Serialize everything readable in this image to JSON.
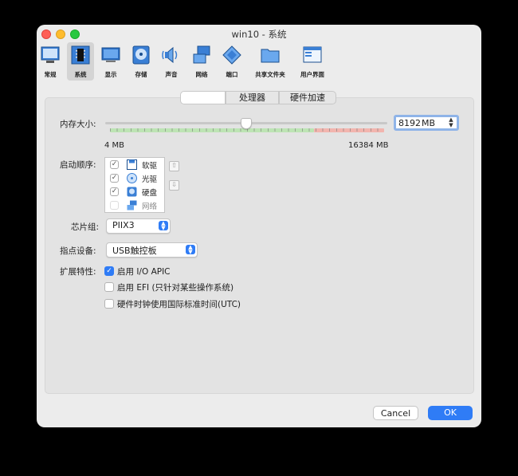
{
  "window": {
    "title": "win10 - 系统"
  },
  "toolbar": [
    {
      "label": "常规",
      "icon": "general-icon"
    },
    {
      "label": "系统",
      "icon": "chip-icon",
      "selected": true
    },
    {
      "label": "显示",
      "icon": "monitor-icon"
    },
    {
      "label": "存储",
      "icon": "storage-icon"
    },
    {
      "label": "声音",
      "icon": "speaker-icon"
    },
    {
      "label": "网络",
      "icon": "network-icon"
    },
    {
      "label": "端口",
      "icon": "port-icon"
    },
    {
      "label": "共享文件夹",
      "icon": "folder-icon"
    },
    {
      "label": "用户界面",
      "icon": "ui-icon"
    }
  ],
  "tabs": [
    {
      "label": "",
      "selected": true
    },
    {
      "label": "处理器"
    },
    {
      "label": "硬件加速"
    }
  ],
  "memory": {
    "label": "内存大小:",
    "value": "8192",
    "unit": "MB",
    "min_label": "4 MB",
    "max_label": "16384 MB",
    "slider_fraction": 0.5
  },
  "boot_order": {
    "label": "启动顺序:",
    "items": [
      {
        "label": "软驱",
        "checked": true,
        "icon": "floppy-icon"
      },
      {
        "label": "光驱",
        "checked": true,
        "icon": "optical-disc-icon"
      },
      {
        "label": "硬盘",
        "checked": true,
        "icon": "hard-disk-icon"
      },
      {
        "label": "网络",
        "checked": false,
        "icon": "network-boot-icon"
      }
    ]
  },
  "chipset": {
    "label": "芯片组:",
    "value": "PIIX3"
  },
  "pointing_device": {
    "label": "指点设备:",
    "value": "USB触控板"
  },
  "extended": {
    "label": "扩展特性:",
    "options": [
      {
        "label": "启用 I/O APIC",
        "checked": true
      },
      {
        "label": "启用 EFI (只针对某些操作系统)",
        "checked": false
      },
      {
        "label": "硬件时钟使用国际标准时间(UTC)",
        "checked": false
      }
    ]
  },
  "buttons": {
    "cancel": "Cancel",
    "ok": "OK"
  },
  "colors": {
    "accent": "#2f7cf6",
    "slider_green": "#bde4b4",
    "slider_red": "#f2b5ae"
  }
}
